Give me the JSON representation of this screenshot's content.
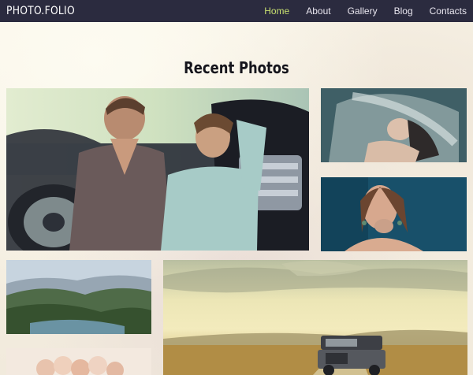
{
  "brand": {
    "logo": "PHOTO.FOLIO"
  },
  "nav": {
    "items": [
      {
        "label": "Home",
        "active": true
      },
      {
        "label": "About",
        "active": false
      },
      {
        "label": "Gallery",
        "active": false
      },
      {
        "label": "Blog",
        "active": false
      },
      {
        "label": "Contacts",
        "active": false
      }
    ],
    "active_color": "#c8e070"
  },
  "section": {
    "title": "Recent Photos"
  },
  "colors": {
    "navbar": "#2b2b3f",
    "background": "#f7f2e4"
  }
}
